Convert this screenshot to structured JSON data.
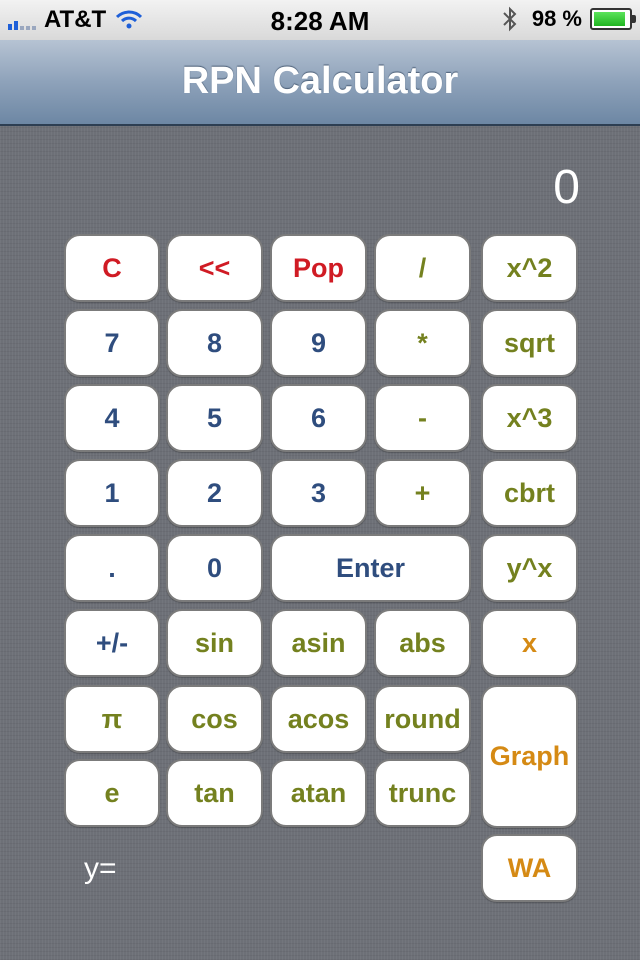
{
  "status_bar": {
    "carrier": "AT&T",
    "time": "8:28 AM",
    "battery": "98 %"
  },
  "navbar": {
    "title": "RPN Calculator"
  },
  "display": {
    "value": "0"
  },
  "function_label": "y=",
  "colors": {
    "red": "#d01b24",
    "blue": "#2f4d7e",
    "olive": "#74811f",
    "orange": "#d58a14"
  },
  "keys": {
    "c": "C",
    "backspace": "<<",
    "pop": "Pop",
    "divide": "/",
    "square": "x^2",
    "seven": "7",
    "eight": "8",
    "nine": "9",
    "multiply": "*",
    "sqrt": "sqrt",
    "four": "4",
    "five": "5",
    "six": "6",
    "minus": "-",
    "cube": "x^3",
    "one": "1",
    "two": "2",
    "three": "3",
    "plus": "+",
    "cbrt": "cbrt",
    "dot": ".",
    "zero": "0",
    "enter": "Enter",
    "power": "y^x",
    "negate": "+/-",
    "sin": "sin",
    "asin": "asin",
    "abs": "abs",
    "x": "x",
    "pi": "π",
    "cos": "cos",
    "acos": "acos",
    "round": "round",
    "graph": "Graph",
    "e": "e",
    "tan": "tan",
    "atan": "atan",
    "trunc": "trunc",
    "wa": "WA"
  }
}
